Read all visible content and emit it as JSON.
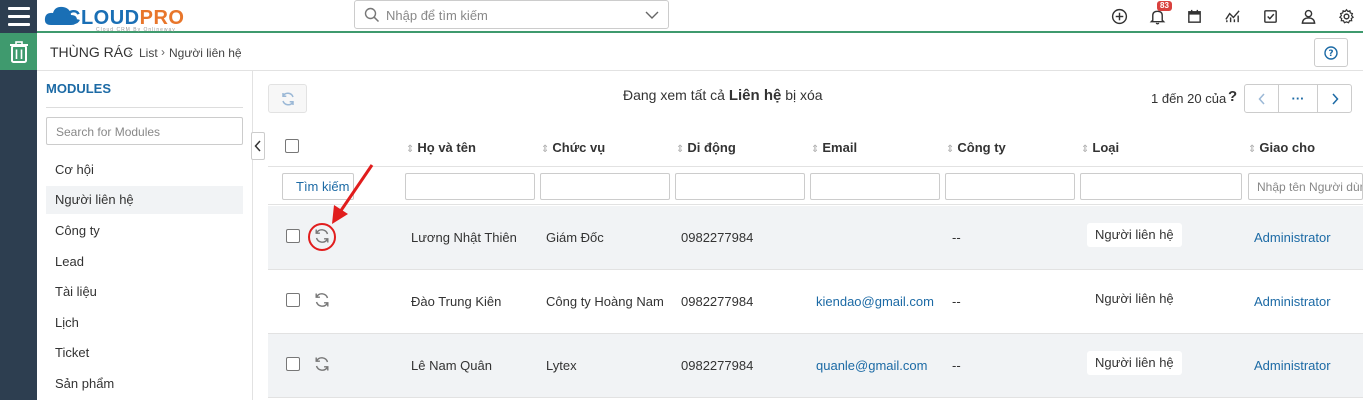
{
  "app": {
    "logo_text_1": "CLOUD",
    "logo_text_2": "PRO",
    "logo_tagline": "Cloud CRM By Onlineway",
    "brand_color": "#1a6fb5",
    "accent_color": "#3f9a6e"
  },
  "topbar": {
    "search_placeholder": "Nhập để tìm kiếm",
    "notification_count": "83",
    "icons": [
      "plus-circle-icon",
      "bell-icon",
      "calendar-icon",
      "chart-icon",
      "checkbox-icon",
      "user-icon",
      "gear-icon"
    ]
  },
  "breadcrumb": {
    "title": "THÙNG RÁC",
    "part1": "List",
    "part2": "Người liên hệ"
  },
  "sidebar": {
    "title": "MODULES",
    "search_placeholder": "Search for Modules",
    "items": [
      {
        "label": "Cơ hội"
      },
      {
        "label": "Người liên hệ",
        "active": true
      },
      {
        "label": "Công ty"
      },
      {
        "label": "Lead"
      },
      {
        "label": "Tài liệu"
      },
      {
        "label": "Lịch"
      },
      {
        "label": "Ticket"
      },
      {
        "label": "Sản phẩm"
      }
    ]
  },
  "content": {
    "viewing_prefix": "Đang xem tất cả",
    "viewing_module": "Liên hệ",
    "viewing_suffix": "bị xóa",
    "pager_text": "1 đến 20 của",
    "pager_help": "?",
    "more_label": "···"
  },
  "table": {
    "columns": [
      "Họ và tên",
      "Chức vụ",
      "Di động",
      "Email",
      "Công ty",
      "Loại",
      "Giao cho"
    ],
    "search_button": "Tìm kiếm",
    "assignee_placeholder": "Nhập tên Người dùng",
    "rows": [
      {
        "name": "Lương Nhật Thiên",
        "title": "Giám Đốc",
        "mobile": "0982277984",
        "email": "",
        "company": "--",
        "type": "Người liên hệ",
        "assignee": "Administrator"
      },
      {
        "name": "Đào Trung Kiên",
        "title": "Công ty Hoàng Nam",
        "mobile": "0982277984",
        "email": "kiendao@gmail.com",
        "company": "--",
        "type": "Người liên hệ",
        "assignee": "Administrator"
      },
      {
        "name": "Lê Nam Quân",
        "title": "Lytex",
        "mobile": "0982277984",
        "email": "quanle@gmail.com",
        "company": "--",
        "type": "Người liên hệ",
        "assignee": "Administrator"
      }
    ]
  }
}
